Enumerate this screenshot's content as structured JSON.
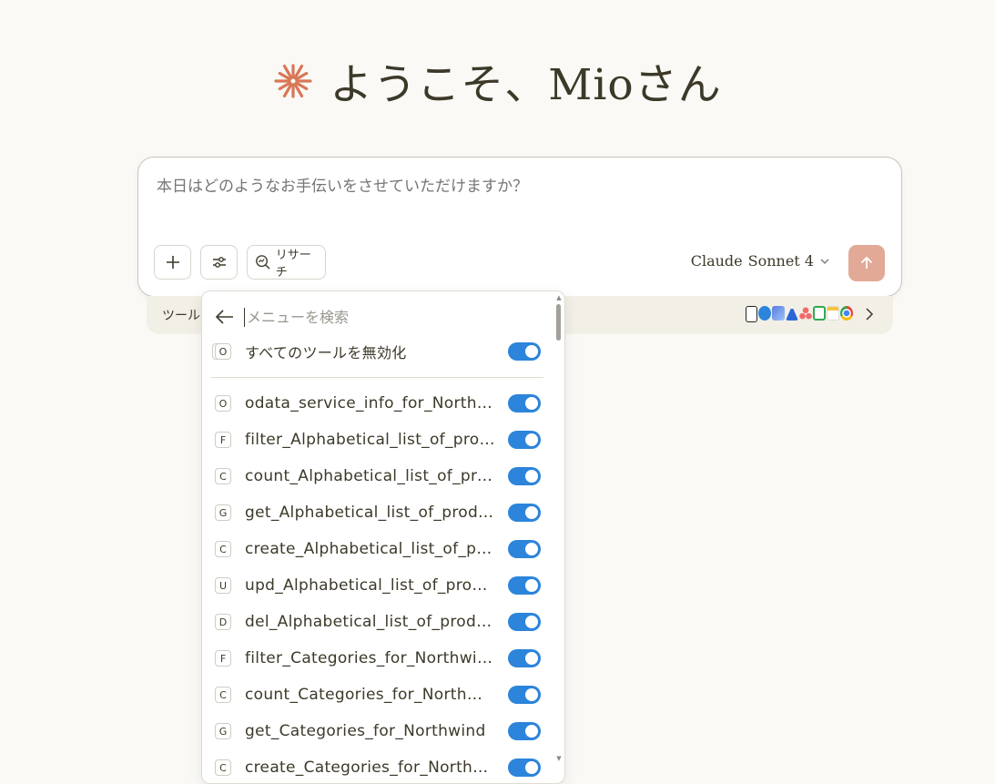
{
  "greeting": {
    "text": "ようこそ、Mioさん",
    "icon": "claude-spark-icon",
    "icon_color": "#d97757"
  },
  "composer": {
    "placeholder": "本日はどのようなお手伝いをさせていただけますか？",
    "research_label": "リサーチ",
    "model_brand": "Claude",
    "model_name": "Sonnet 4",
    "send_color": "#e2a996"
  },
  "tools_bar": {
    "label": "ツールを",
    "connector_icons": [
      "notion-icon",
      "c-app-icon",
      "s-app-icon",
      "a-app-icon",
      "asana-icon",
      "g-app-icon",
      "notes-icon",
      "chrome-icon"
    ]
  },
  "menu": {
    "search_placeholder": "メニューを検索",
    "disable_all": {
      "badge": "O",
      "label": "すべてのツールを無効化",
      "enabled": true
    },
    "toggle_color": "#2c84db",
    "items": [
      {
        "badge": "O",
        "label": "odata_service_info_for_Northwind",
        "enabled": true
      },
      {
        "badge": "F",
        "label": "filter_Alphabetical_list_of_products",
        "enabled": true
      },
      {
        "badge": "C",
        "label": "count_Alphabetical_list_of_products",
        "enabled": true
      },
      {
        "badge": "G",
        "label": "get_Alphabetical_list_of_products",
        "enabled": true
      },
      {
        "badge": "C",
        "label": "create_Alphabetical_list_of_products",
        "enabled": true
      },
      {
        "badge": "U",
        "label": "upd_Alphabetical_list_of_products",
        "enabled": true
      },
      {
        "badge": "D",
        "label": "del_Alphabetical_list_of_products",
        "enabled": true
      },
      {
        "badge": "F",
        "label": "filter_Categories_for_Northwind",
        "enabled": true
      },
      {
        "badge": "C",
        "label": "count_Categories_for_Northwind",
        "enabled": true
      },
      {
        "badge": "G",
        "label": "get_Categories_for_Northwind",
        "enabled": true
      },
      {
        "badge": "C",
        "label": "create_Categories_for_Northwind",
        "enabled": true
      }
    ]
  }
}
